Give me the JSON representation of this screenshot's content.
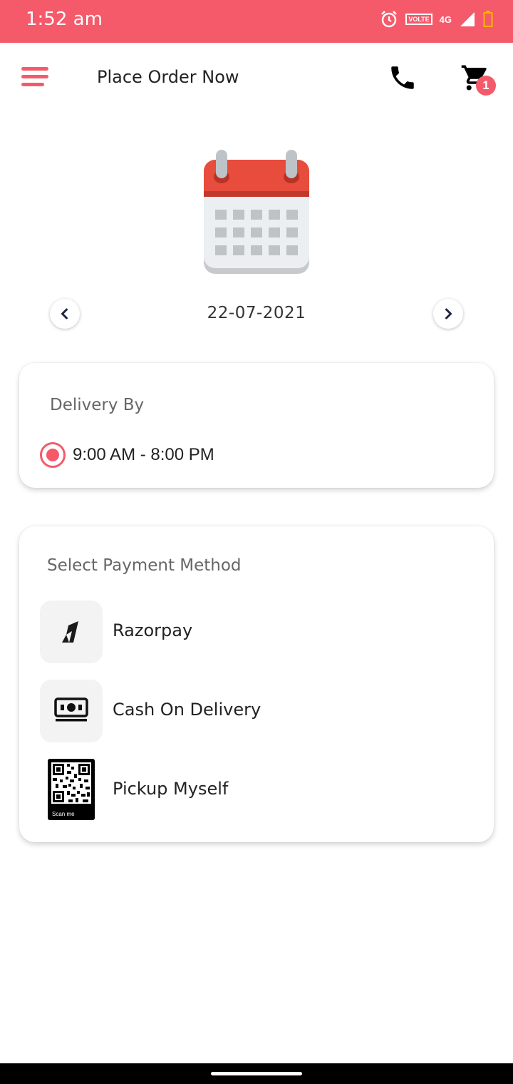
{
  "status_bar": {
    "time": "1:52 am",
    "volte": "VOLTE",
    "network": "4G"
  },
  "header": {
    "title": "Place Order Now",
    "cart_count": "1"
  },
  "date_picker": {
    "date": "22-07-2021"
  },
  "delivery": {
    "title": "Delivery By",
    "slots": [
      {
        "label": "9:00 AM - 8:00 PM",
        "selected": true
      }
    ]
  },
  "payment": {
    "title": "Select Payment Method",
    "methods": [
      {
        "label": "Razorpay",
        "icon": "razorpay-icon"
      },
      {
        "label": "Cash On Delivery",
        "icon": "cash-icon"
      },
      {
        "label": "Pickup Myself",
        "icon": "qr-code-icon"
      }
    ],
    "qr_caption": "Scan me"
  },
  "colors": {
    "accent": "#f55a6a",
    "calendar_red": "#e74c3c"
  }
}
